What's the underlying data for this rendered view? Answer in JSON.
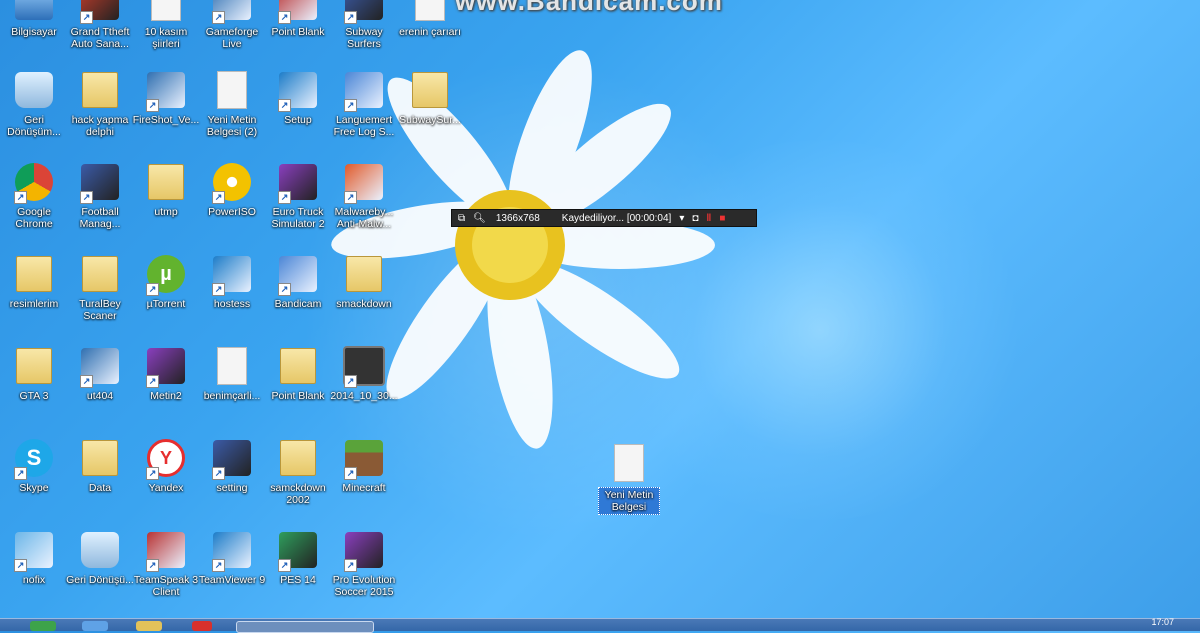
{
  "watermark": "www.Bandicam.com",
  "recorder": {
    "resolution": "1366x768",
    "status": "Kaydediliyor... [00:00:04]"
  },
  "desktop_icons": [
    {
      "label": "Bilgisayar",
      "type": "computer"
    },
    {
      "label": "Grand Ttheft Auto Sana...",
      "type": "game"
    },
    {
      "label": "10 kasım şiirleri",
      "type": "doc"
    },
    {
      "label": "Gameforge Live",
      "type": "app"
    },
    {
      "label": "Point Blank",
      "type": "app"
    },
    {
      "label": "Subway Surfers",
      "type": "game"
    },
    {
      "label": "erenin çarıarı",
      "type": "doc"
    },
    {
      "label": "Geri Dönüşüm...",
      "type": "recycle"
    },
    {
      "label": "hack yapma delphi",
      "type": "folder"
    },
    {
      "label": "FireShot_Ve...",
      "type": "app"
    },
    {
      "label": "Yeni Metin Belgesi (2)",
      "type": "doc"
    },
    {
      "label": "Setup",
      "type": "app"
    },
    {
      "label": "Languemert Free Log S...",
      "type": "app"
    },
    {
      "label": "SubwaySur...",
      "type": "folder"
    },
    {
      "label": "Google Chrome",
      "type": "chrome"
    },
    {
      "label": "Football Manag...",
      "type": "game"
    },
    {
      "label": "utmp",
      "type": "folder"
    },
    {
      "label": "PowerISO",
      "type": "disc"
    },
    {
      "label": "Euro Truck Simulator 2",
      "type": "game"
    },
    {
      "label": "Malwareby... Anti-Malw...",
      "type": "app"
    },
    {
      "label": "resimlerim",
      "type": "folder"
    },
    {
      "label": "TuralBey Scaner",
      "type": "folder"
    },
    {
      "label": "µTorrent",
      "type": "torrent"
    },
    {
      "label": "hostess",
      "type": "app"
    },
    {
      "label": "Bandicam",
      "type": "app"
    },
    {
      "label": "smackdown",
      "type": "folder"
    },
    {
      "label": "GTA 3",
      "type": "folder"
    },
    {
      "label": "ut404",
      "type": "app"
    },
    {
      "label": "Metin2",
      "type": "game"
    },
    {
      "label": "benimçarli...",
      "type": "doc"
    },
    {
      "label": "Point Blank",
      "type": "folder"
    },
    {
      "label": "2014_10_30...",
      "type": "video"
    },
    {
      "label": "Skype",
      "type": "skype"
    },
    {
      "label": "Data",
      "type": "folder"
    },
    {
      "label": "Yandex",
      "type": "yandex"
    },
    {
      "label": "setting",
      "type": "game"
    },
    {
      "label": "samckdown 2002",
      "type": "folder"
    },
    {
      "label": "Minecraft",
      "type": "minecraft"
    },
    {
      "label": "nofix",
      "type": "app"
    },
    {
      "label": "Geri Dönüşü...",
      "type": "recycle"
    },
    {
      "label": "TeamSpeak 3 Client",
      "type": "app"
    },
    {
      "label": "TeamViewer 9",
      "type": "app"
    },
    {
      "label": "PES 14",
      "type": "game"
    },
    {
      "label": "Pro Evolution Soccer 2015",
      "type": "game"
    }
  ],
  "selected_icon": {
    "label": "Yeni Metin Belgesi",
    "type": "doc"
  },
  "taskbar": {
    "clock": "17:07"
  }
}
